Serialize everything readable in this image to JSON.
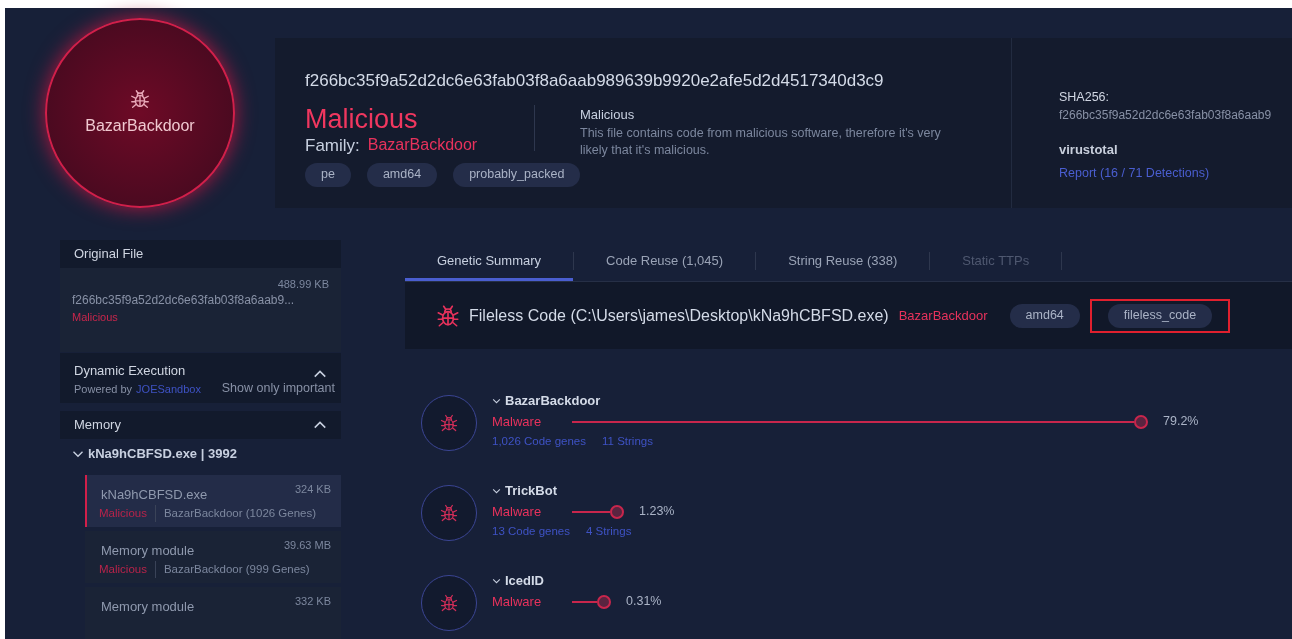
{
  "header": {
    "family_badge": "BazarBackdoor",
    "hash": "f266bc35f9a52d2dc6e63fab03f8a6aab989639b9920e2afe5d2d4517340d3c9",
    "verdict": "Malicious",
    "family_label": "Family:",
    "family": "BazarBackdoor",
    "tags": [
      "pe",
      "amd64",
      "probably_packed"
    ],
    "verdict_title": "Malicious",
    "verdict_text": "This file contains code from malicious software, therefore it's very likely that it's malicious."
  },
  "info": {
    "sha_label": "SHA256:",
    "sha": "f266bc35f9a52d2dc6e63fab03f8a6aab9",
    "vt_logo": "virustotal",
    "vt_link": "Report (16 / 71 Detections)"
  },
  "sidebar": {
    "original_file": {
      "title": "Original File",
      "name": "f266bc35f9a52d2dc6e63fab03f8a6aab9...",
      "size": "488.99 KB",
      "verdict": "Malicious"
    },
    "dynamic": {
      "title": "Dynamic Execution",
      "powered": "Powered by",
      "provider": "JOESandbox",
      "filter": "Show only important",
      "expanded": true
    },
    "memory": {
      "title": "Memory",
      "expanded": true,
      "process": {
        "name": "kNa9hCBFSD.exe | 3992",
        "expanded": true,
        "items": [
          {
            "name": "kNa9hCBFSD.exe",
            "size": "324 KB",
            "verdict": "Malicious",
            "family": "BazarBackdoor (1026 Genes)",
            "selected": true
          },
          {
            "name": "Memory module",
            "size": "39.63 MB",
            "verdict": "Malicious",
            "family": "BazarBackdoor (999 Genes)",
            "selected": false
          },
          {
            "name": "Memory module",
            "size": "332 KB",
            "selected": false
          }
        ]
      }
    }
  },
  "tabs": [
    {
      "label": "Genetic Summary",
      "selected": true,
      "disabled": false
    },
    {
      "label": "Code Reuse (1,045)",
      "selected": false,
      "disabled": false
    },
    {
      "label": "String Reuse (338)",
      "selected": false,
      "disabled": false
    },
    {
      "label": "Static TTPs",
      "selected": false,
      "disabled": true
    }
  ],
  "module": {
    "title": "Fileless Code (C:\\Users\\james\\Desktop\\kNa9hCBFSD.exe)",
    "family": "BazarBackdoor",
    "tags": [
      {
        "label": "amd64",
        "highlighted": false
      },
      {
        "label": "fileless_code",
        "highlighted": true
      }
    ]
  },
  "families": [
    {
      "name": "BazarBackdoor",
      "type": "Malware",
      "reading": "79.2%",
      "genes": "1,026 Code genes",
      "strings": "11 Strings",
      "expanded": true
    },
    {
      "name": "TrickBot",
      "type": "Malware",
      "reading": "1.23%",
      "genes": "13 Code genes",
      "strings": "4 Strings",
      "expanded": true
    },
    {
      "name": "IcedID",
      "type": "Malware",
      "reading": "0.31%",
      "expanded": true
    }
  ]
}
